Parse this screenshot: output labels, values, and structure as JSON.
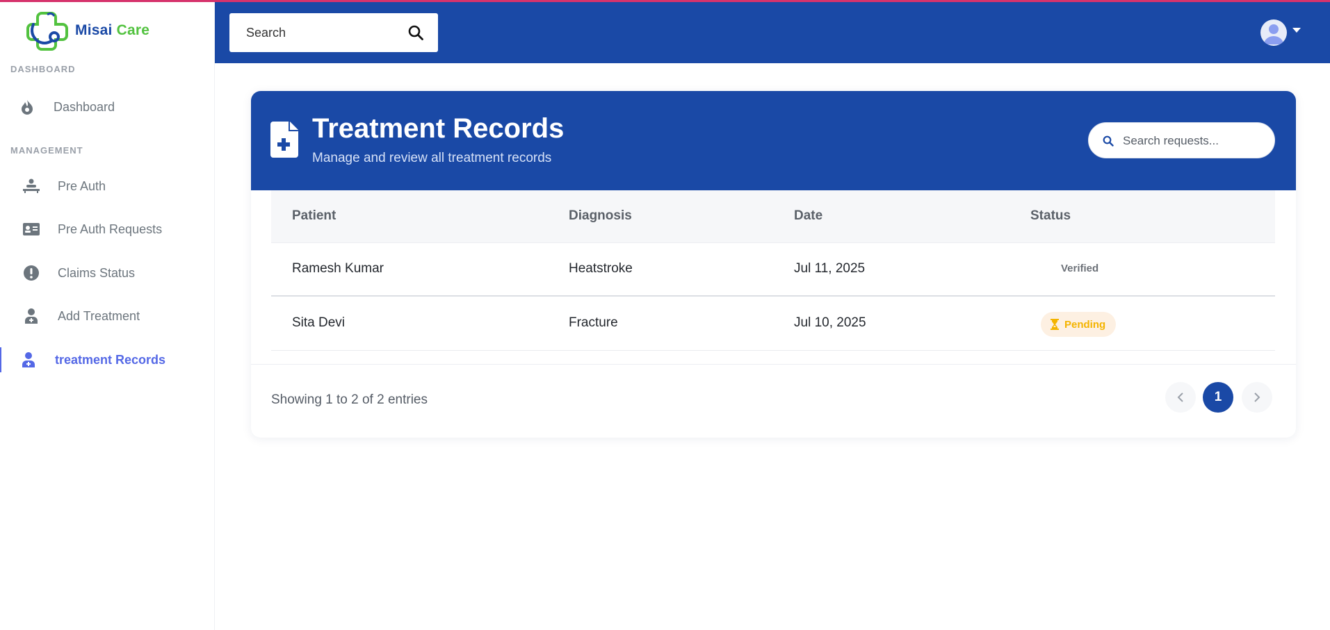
{
  "brand": {
    "name_part1": "Misai",
    "name_part2": "Care",
    "primary_color": "#1a49a6",
    "accent_green": "#52c23f"
  },
  "sidebar": {
    "sections": [
      {
        "label": "DASHBOARD",
        "items": [
          {
            "label": "Dashboard",
            "icon": "fire-icon"
          }
        ]
      },
      {
        "label": "MANAGEMENT",
        "items": [
          {
            "label": "Pre Auth",
            "icon": "procedures-icon"
          },
          {
            "label": "Pre Auth Requests",
            "icon": "id-card-icon"
          },
          {
            "label": "Claims Status",
            "icon": "exclamation-circle-icon"
          },
          {
            "label": "Add Treatment",
            "icon": "user-doctor-icon"
          },
          {
            "label": "treatment Records",
            "icon": "user-doctor-icon",
            "active": true
          }
        ]
      }
    ]
  },
  "topbar": {
    "search_text": "Search",
    "search_icon": "search-icon",
    "avatar_icon": "user-avatar-icon"
  },
  "card": {
    "title": "Treatment Records",
    "subtitle": "Manage and review all treatment records",
    "search_placeholder": "Search requests...",
    "icon": "file-medical-icon"
  },
  "table": {
    "headers": [
      "Patient",
      "Diagnosis",
      "Date",
      "Status"
    ],
    "rows": [
      {
        "patient": "Ramesh Kumar",
        "diagnosis": "Heatstroke",
        "date": "Jul 11, 2025",
        "status": "Verified"
      },
      {
        "patient": "Sita Devi",
        "diagnosis": "Fracture",
        "date": "Jul 10, 2025",
        "status": "Pending"
      }
    ]
  },
  "pagination": {
    "summary": "Showing 1 to 2 of 2 entries",
    "current_page": "1"
  }
}
